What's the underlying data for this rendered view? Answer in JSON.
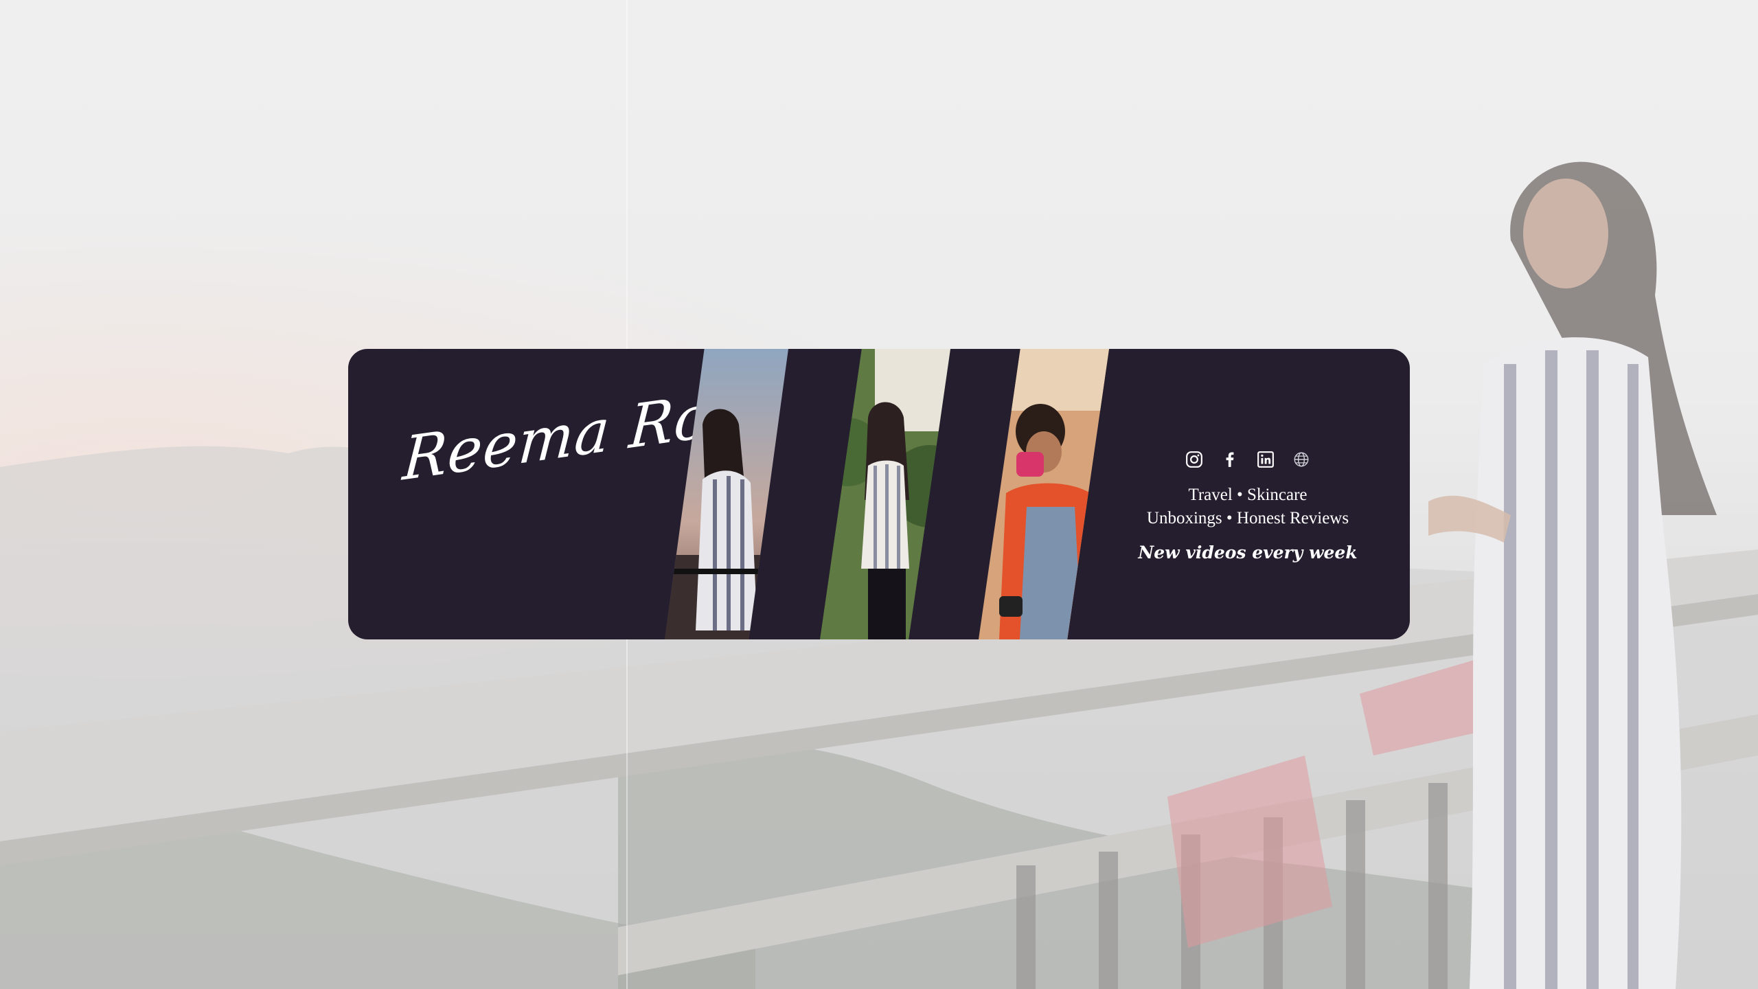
{
  "banner": {
    "name": "Reema Roy",
    "tagline_line1": "Travel • Skincare",
    "tagline_line2": "Unboxings • Honest Reviews",
    "cta": "New videos every week"
  },
  "socials": [
    {
      "icon": "instagram-icon"
    },
    {
      "icon": "facebook-icon"
    },
    {
      "icon": "linkedin-icon"
    },
    {
      "icon": "globe-icon"
    }
  ],
  "colors": {
    "banner_bg": "#241e2e",
    "text": "#ffffff"
  }
}
